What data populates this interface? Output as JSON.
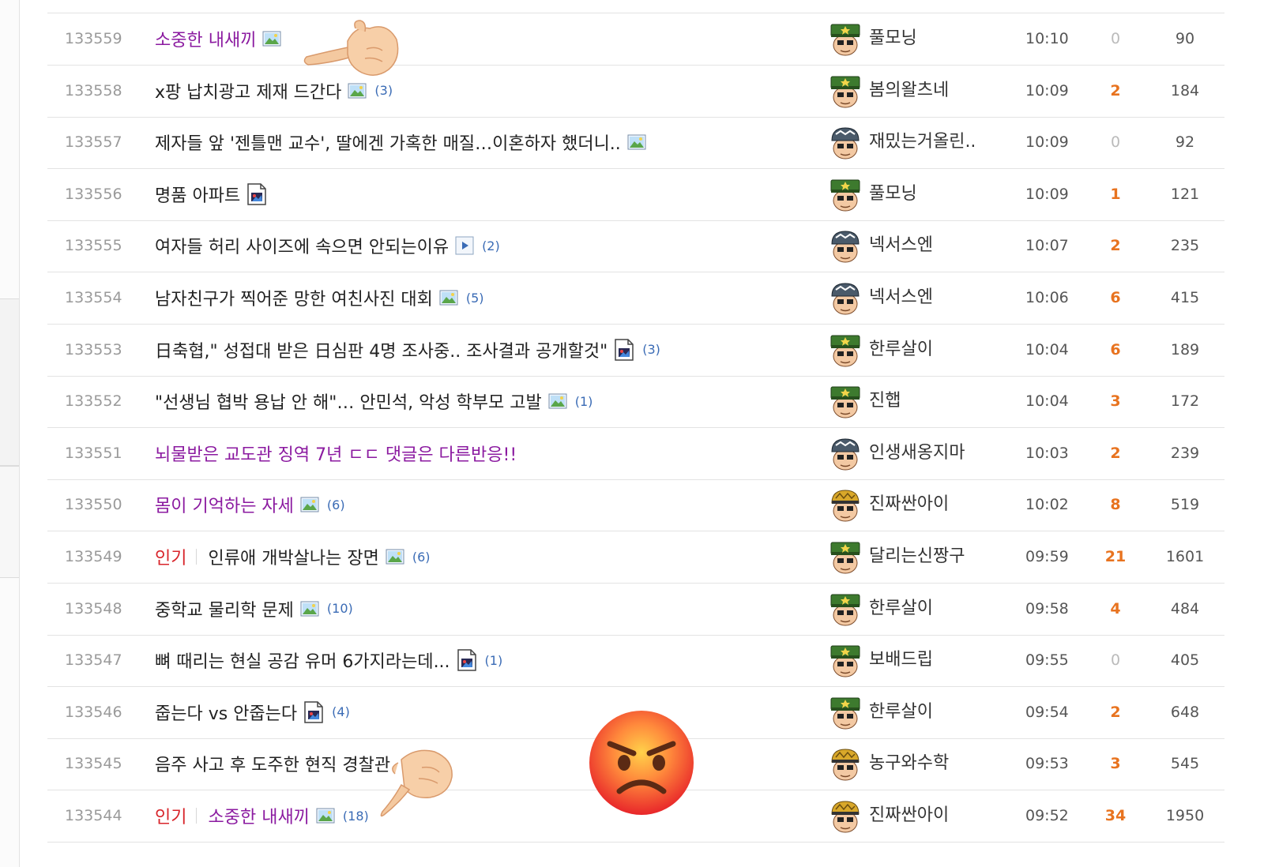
{
  "colors": {
    "title_purple": "#8b1aa0",
    "hot_tag": "#d8242a",
    "reply_highlight": "#e8731f",
    "comment_count": "#3a6bb5"
  },
  "rows": [
    {
      "num": "133559",
      "tag": "",
      "title": "소중한 내새끼",
      "purple": true,
      "icon": "image-icon",
      "comments": "",
      "nick": "풀모닝",
      "avatar": "soldier-green-avatar",
      "time": "10:10",
      "replies": "0",
      "views": "90"
    },
    {
      "num": "133558",
      "tag": "",
      "title": "x팡 납치광고 제재 드간다",
      "purple": false,
      "icon": "image-icon",
      "comments": "(3)",
      "nick": "봄의왈츠네",
      "avatar": "soldier-green-avatar",
      "time": "10:09",
      "replies": "2",
      "views": "184"
    },
    {
      "num": "133557",
      "tag": "",
      "title": "제자들 앞 '젠틀맨 교수', 딸에겐 가혹한 매질…이혼하자 했더니..",
      "purple": false,
      "icon": "image-icon",
      "comments": "",
      "nick": "재밌는거올린..",
      "avatar": "helmet-dark-avatar",
      "time": "10:09",
      "replies": "0",
      "views": "92"
    },
    {
      "num": "133556",
      "tag": "",
      "title": "명품 아파트",
      "purple": false,
      "icon": "file-image-icon",
      "comments": "",
      "nick": "풀모닝",
      "avatar": "soldier-green-avatar",
      "time": "10:09",
      "replies": "1",
      "views": "121"
    },
    {
      "num": "133555",
      "tag": "",
      "title": "여자들 허리 사이즈에 속으면 안되는이유",
      "purple": false,
      "icon": "video-icon",
      "comments": "(2)",
      "nick": "넥서스엔",
      "avatar": "helmet-dark-avatar",
      "time": "10:07",
      "replies": "2",
      "views": "235"
    },
    {
      "num": "133554",
      "tag": "",
      "title": "남자친구가 찍어준 망한 여친사진 대회",
      "purple": false,
      "icon": "image-icon",
      "comments": "(5)",
      "nick": "넥서스엔",
      "avatar": "helmet-dark-avatar",
      "time": "10:06",
      "replies": "6",
      "views": "415"
    },
    {
      "num": "133553",
      "tag": "",
      "title": "日축협,\" 성접대 받은 日심판 4명 조사중.. 조사결과 공개할것\"",
      "purple": false,
      "icon": "file-image-icon",
      "comments": "(3)",
      "nick": "한루살이",
      "avatar": "soldier-green-avatar",
      "time": "10:04",
      "replies": "6",
      "views": "189"
    },
    {
      "num": "133552",
      "tag": "",
      "title": "\"선생님 협박 용납 안 해\"… 안민석, 악성 학부모 고발",
      "purple": false,
      "icon": "image-icon",
      "comments": "(1)",
      "nick": "진햅",
      "avatar": "soldier-green-avatar",
      "time": "10:04",
      "replies": "3",
      "views": "172"
    },
    {
      "num": "133551",
      "tag": "",
      "title": "뇌물받은 교도관 징역 7년 ㄷㄷ 댓글은 다른반응!!",
      "purple": true,
      "icon": "",
      "comments": "",
      "nick": "인생새옹지마",
      "avatar": "helmet-dark-avatar",
      "time": "10:03",
      "replies": "2",
      "views": "239"
    },
    {
      "num": "133550",
      "tag": "",
      "title": "몸이 기억하는 자세",
      "purple": true,
      "icon": "image-icon",
      "comments": "(6)",
      "nick": "진짜싼아이",
      "avatar": "helmet-gold-avatar",
      "time": "10:02",
      "replies": "8",
      "views": "519"
    },
    {
      "num": "133549",
      "tag": "인기",
      "title": "인류애 개박살나는 장면",
      "purple": false,
      "icon": "image-icon",
      "comments": "(6)",
      "nick": "달리는신짱구",
      "avatar": "soldier-green-avatar",
      "time": "09:59",
      "replies": "21",
      "views": "1601"
    },
    {
      "num": "133548",
      "tag": "",
      "title": "중학교 물리학 문제",
      "purple": false,
      "icon": "image-icon",
      "comments": "(10)",
      "nick": "한루살이",
      "avatar": "soldier-green-avatar",
      "time": "09:58",
      "replies": "4",
      "views": "484"
    },
    {
      "num": "133547",
      "tag": "",
      "title": "뼈 때리는 현실 공감 유머 6가지라는데...",
      "purple": false,
      "icon": "file-image-icon",
      "comments": "(1)",
      "nick": "보배드립",
      "avatar": "soldier-green-avatar",
      "time": "09:55",
      "replies": "0",
      "views": "405"
    },
    {
      "num": "133546",
      "tag": "",
      "title": "줍는다 vs 안줍는다",
      "purple": false,
      "icon": "file-image-icon",
      "comments": "(4)",
      "nick": "한루살이",
      "avatar": "soldier-green-avatar",
      "time": "09:54",
      "replies": "2",
      "views": "648"
    },
    {
      "num": "133545",
      "tag": "",
      "title": "음주 사고 후 도주한 현직 경찰관",
      "purple": false,
      "icon": "",
      "comments": "",
      "nick": "농구와수학",
      "avatar": "helmet-gold-avatar",
      "time": "09:53",
      "replies": "3",
      "views": "545"
    },
    {
      "num": "133544",
      "tag": "인기",
      "title": "소중한 내새끼",
      "purple": true,
      "icon": "image-icon",
      "comments": "(18)",
      "nick": "진짜싼아이",
      "avatar": "helmet-gold-avatar",
      "time": "09:52",
      "replies": "34",
      "views": "1950"
    }
  ],
  "overlays": [
    "pointing-hand-emoji-left",
    "pointing-hand-emoji-down",
    "angry-face-emoji"
  ]
}
